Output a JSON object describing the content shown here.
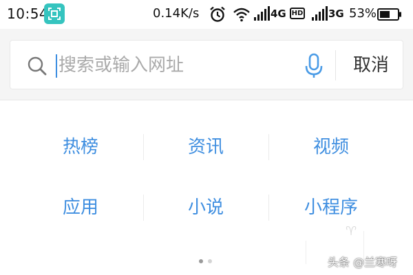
{
  "status_bar": {
    "time": "10:54",
    "net_speed": "0.14K/s",
    "sim1_type": "4G",
    "hd_badge": "HD",
    "sim2_type": "3G",
    "battery": "53%",
    "icons": [
      "screenshot-icon",
      "alarm-icon",
      "wifi-icon",
      "signal-icon",
      "hd-icon",
      "signal-icon",
      "battery-icon"
    ]
  },
  "search": {
    "placeholder": "搜索或输入网址",
    "value": "",
    "cancel_label": "取消"
  },
  "categories": [
    {
      "label": "热榜"
    },
    {
      "label": "资讯"
    },
    {
      "label": "视频"
    },
    {
      "label": "应用"
    },
    {
      "label": "小说"
    },
    {
      "label": "小程序"
    }
  ],
  "pager": {
    "pages": 2,
    "active": 1
  },
  "watermark": "头条 @兰寒呀",
  "colors": {
    "accent_blue": "#3e8ee0",
    "screenshot_badge": "#35c4bf",
    "search_bg": "#f5f5f5",
    "text_dark": "#222222",
    "mic_blue": "#4a9be6"
  }
}
